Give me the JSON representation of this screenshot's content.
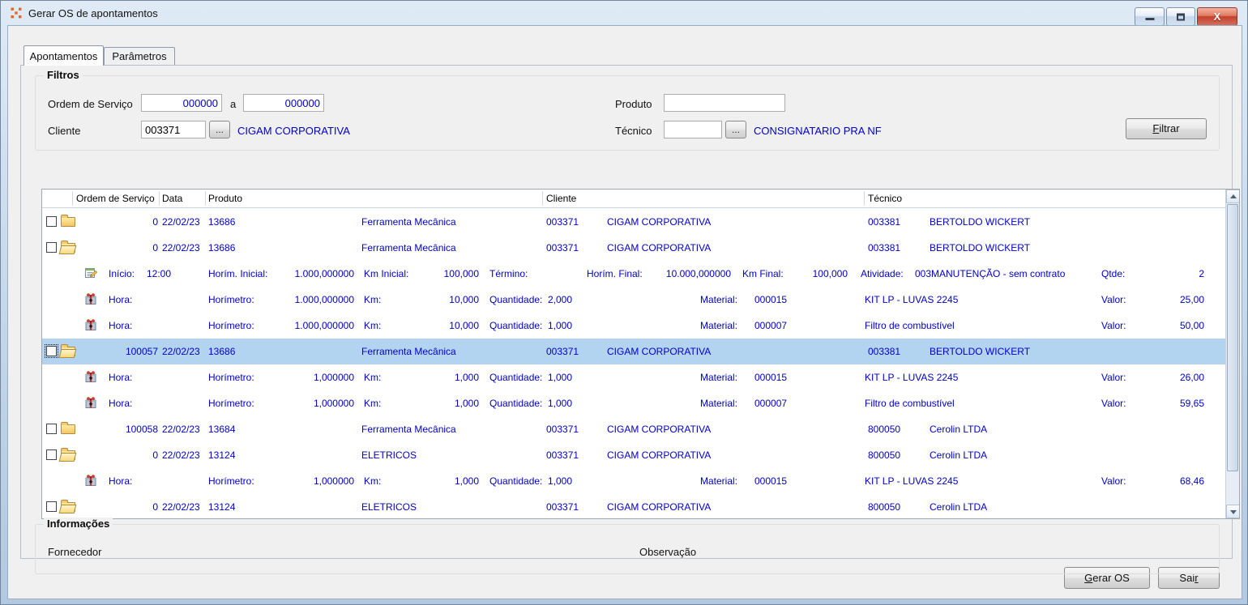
{
  "window": {
    "title": "Gerar OS de apontamentos"
  },
  "window_controls": {
    "minimize": "minimize",
    "maximize": "maximize",
    "close": "close",
    "close_glyph": "X"
  },
  "icons": {
    "window_logo": "cigam-logo",
    "folder_closed": "folder-closed",
    "folder_open": "folder-open",
    "apontamento": "note-edit",
    "material": "package-gift",
    "scroll_up": "chevron-up",
    "scroll_down": "chevron-down"
  },
  "colors": {
    "data_text": "#0000c8",
    "selected_row": "#b2d4f1",
    "frame": "#c3d7ec",
    "close_button": "#c2402e"
  },
  "tabs": [
    {
      "label": "Apontamentos",
      "active": true
    },
    {
      "label": "Parâmetros",
      "active": false
    }
  ],
  "filters": {
    "legend": "Filtros",
    "os_label": "Ordem de Serviço",
    "os_from": "000000",
    "os_sep": "a",
    "os_to": "000000",
    "cliente_label": "Cliente",
    "cliente_code": "003371",
    "cliente_name": "CIGAM CORPORATIVA",
    "produto_label": "Produto",
    "produto_value": "",
    "tecnico_label": "Técnico",
    "tecnico_code": "",
    "tecnico_name": "CONSIGNATARIO PRA NF",
    "browse": "...",
    "filtrar": {
      "pre": "",
      "key": "F",
      "post": "iltrar"
    }
  },
  "grid": {
    "headers": {
      "os": "Ordem de Serviço",
      "data": "Data",
      "produto": "Produto",
      "cliente": "Cliente",
      "tecnico": "Técnico"
    },
    "labels": {
      "inicio": "Início:",
      "horim_inicial": "Horím. Inicial:",
      "km_inicial": "Km Inicial:",
      "termino": "Término:",
      "horim_final": "Horím. Final:",
      "km_final": "Km Final:",
      "atividade": "Atividade:",
      "qtde": "Qtde:",
      "hora": "Hora:",
      "horimetro": "Horímetro:",
      "km": "Km:",
      "quantidade": "Quantidade:",
      "material": "Material:",
      "valor": "Valor:"
    },
    "rows": [
      {
        "type": "os",
        "folder": "closed",
        "checked": false,
        "os": "0",
        "data": "22/02/23",
        "prod_cod": "13686",
        "prod_desc": "Ferramenta Mecânica",
        "cli_cod": "003371",
        "cli_nome": "CIGAM CORPORATIVA",
        "tec_cod": "003381",
        "tec_nome": "BERTOLDO WICKERT"
      },
      {
        "type": "os",
        "folder": "open",
        "checked": false,
        "os": "0",
        "data": "22/02/23",
        "prod_cod": "13686",
        "prod_desc": "Ferramenta Mecânica",
        "cli_cod": "003371",
        "cli_nome": "CIGAM CORPORATIVA",
        "tec_cod": "003381",
        "tec_nome": "BERTOLDO WICKERT"
      },
      {
        "type": "apontamento",
        "inicio": "12:00",
        "horim_inicial": "1.000,000000",
        "km_inicial": "100,000",
        "termino": "",
        "horim_final": "10.000,000000",
        "km_final": "100,000",
        "ativ_cod": "003",
        "ativ_desc": "MANUTENÇÃO - sem contrato",
        "qtde": "2"
      },
      {
        "type": "material",
        "hora": "",
        "horimetro": "1.000,000000",
        "km": "10,000",
        "quantidade": "2,000",
        "mat_cod": "000015",
        "mat_desc": "KIT LP - LUVAS 2245",
        "valor": "25,00"
      },
      {
        "type": "material",
        "hora": "",
        "horimetro": "1.000,000000",
        "km": "10,000",
        "quantidade": "1,000",
        "mat_cod": "000007",
        "mat_desc": "Filtro de combustível",
        "valor": "50,00"
      },
      {
        "type": "os",
        "folder": "open",
        "checked": false,
        "selected": true,
        "os": "100057",
        "data": "22/02/23",
        "prod_cod": "13686",
        "prod_desc": "Ferramenta Mecânica",
        "cli_cod": "003371",
        "cli_nome": "CIGAM CORPORATIVA",
        "tec_cod": "003381",
        "tec_nome": "BERTOLDO WICKERT"
      },
      {
        "type": "material",
        "hora": "",
        "horimetro": "1,000000",
        "km": "1,000",
        "quantidade": "1,000",
        "mat_cod": "000015",
        "mat_desc": "KIT LP - LUVAS 2245",
        "valor": "26,00"
      },
      {
        "type": "material",
        "hora": "",
        "horimetro": "1,000000",
        "km": "1,000",
        "quantidade": "1,000",
        "mat_cod": "000007",
        "mat_desc": "Filtro de combustível",
        "valor": "59,65"
      },
      {
        "type": "os",
        "folder": "closed",
        "checked": false,
        "os": "100058",
        "data": "22/02/23",
        "prod_cod": "13684",
        "prod_desc": "Ferramenta Mecânica",
        "cli_cod": "003371",
        "cli_nome": "CIGAM CORPORATIVA",
        "tec_cod": "800050",
        "tec_nome": "Cerolin LTDA"
      },
      {
        "type": "os",
        "folder": "open",
        "checked": false,
        "os": "0",
        "data": "22/02/23",
        "prod_cod": "13124",
        "prod_desc": "ELETRICOS",
        "cli_cod": "003371",
        "cli_nome": "CIGAM CORPORATIVA",
        "tec_cod": "800050",
        "tec_nome": "Cerolin LTDA"
      },
      {
        "type": "material",
        "hora": "",
        "horimetro": "1,000000",
        "km": "1,000",
        "quantidade": "1,000",
        "mat_cod": "000015",
        "mat_desc": "KIT LP - LUVAS 2245",
        "valor": "68,46"
      },
      {
        "type": "os",
        "folder": "open",
        "checked": false,
        "os": "0",
        "data": "22/02/23",
        "prod_cod": "13124",
        "prod_desc": "ELETRICOS",
        "cli_cod": "003371",
        "cli_nome": "CIGAM CORPORATIVA",
        "tec_cod": "800050",
        "tec_nome": "Cerolin LTDA"
      }
    ]
  },
  "info": {
    "legend": "Informações",
    "fornecedor": "Fornecedor",
    "observacao": "Observação"
  },
  "footer": {
    "gerar": {
      "pre": "",
      "key": "G",
      "post": "erar OS"
    },
    "sair": {
      "pre": "Sai",
      "key": "r",
      "post": ""
    }
  }
}
